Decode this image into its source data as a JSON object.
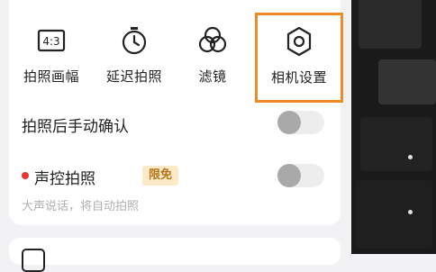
{
  "quick_settings": {
    "aspect_ratio": {
      "icon_text": "4:3",
      "label": "拍照画幅"
    },
    "delayed_shot": {
      "label": "延迟拍照"
    },
    "filter": {
      "label": "滤镜"
    },
    "camera_settings": {
      "label": "相机设置",
      "highlight_color": "#f08a24"
    }
  },
  "settings": {
    "manual_confirm": {
      "label": "拍照后手动确认",
      "enabled": false
    },
    "voice_shutter": {
      "label": "声控拍照",
      "badge": "限免",
      "hint": "大声说话，将自动拍照",
      "enabled": false
    }
  },
  "colors": {
    "accent_orange": "#f08a24",
    "red_dot": "#e8372c",
    "badge_bg": "#fbe9c8",
    "badge_text": "#b5761c"
  }
}
